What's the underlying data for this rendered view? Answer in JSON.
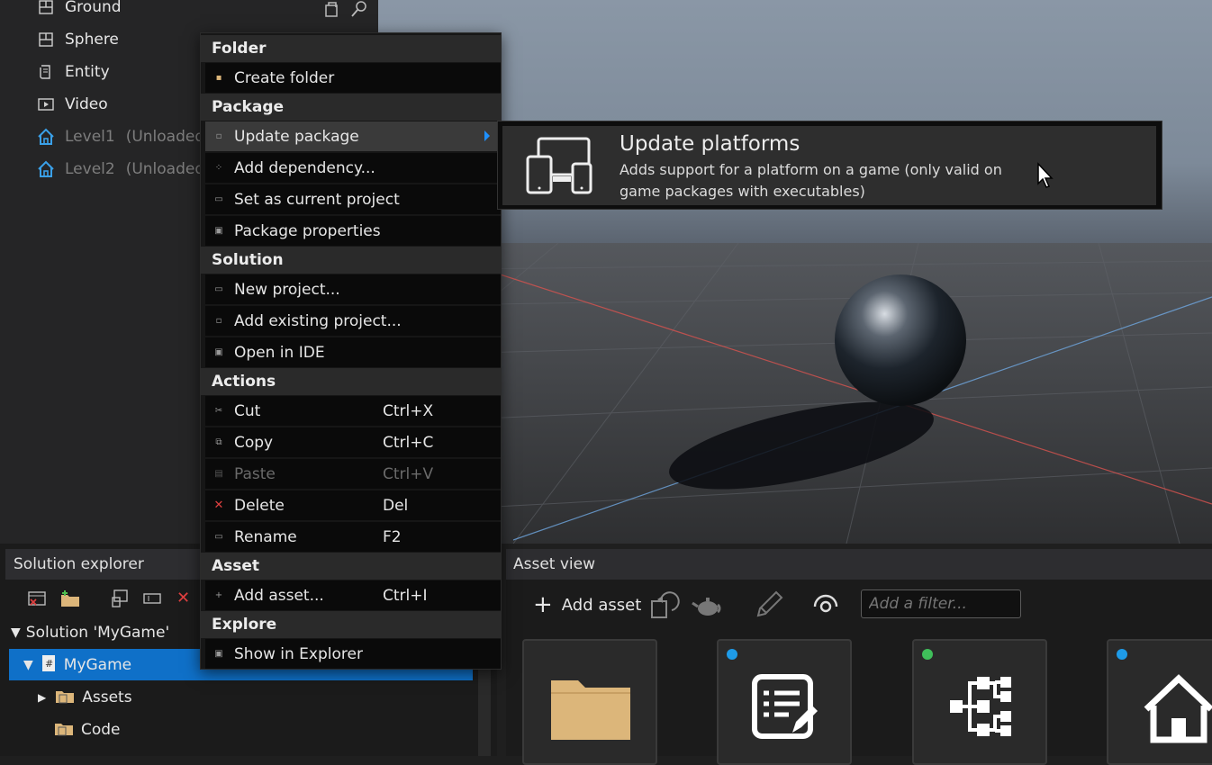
{
  "scene_tree": {
    "items": [
      {
        "label": "Ground",
        "icon": "entity-mesh-icon",
        "extra": ""
      },
      {
        "label": "Sphere",
        "icon": "entity-mesh-icon",
        "extra": ""
      },
      {
        "label": "Entity",
        "icon": "entity-script-icon",
        "extra": ""
      },
      {
        "label": "Video",
        "icon": "video-icon",
        "extra": ""
      },
      {
        "label": "Level1",
        "icon": "home-icon",
        "extra": "(Unloaded)"
      },
      {
        "label": "Level2",
        "icon": "home-icon",
        "extra": "(Unloaded)"
      }
    ]
  },
  "context_menu": {
    "sections": {
      "folder": "Folder",
      "package": "Package",
      "solution": "Solution",
      "actions": "Actions",
      "asset": "Asset",
      "explore": "Explore"
    },
    "items": {
      "create_folder": "Create folder",
      "update_package": "Update package",
      "add_dependency": "Add dependency...",
      "set_current": "Set as current project",
      "package_properties": "Package properties",
      "new_project": "New project...",
      "add_existing": "Add existing project...",
      "open_ide": "Open in IDE",
      "cut": "Cut",
      "copy": "Copy",
      "paste": "Paste",
      "delete": "Delete",
      "rename": "Rename",
      "add_asset": "Add asset...",
      "show_explorer": "Show in Explorer"
    },
    "shortcuts": {
      "cut": "Ctrl+X",
      "copy": "Ctrl+C",
      "paste": "Ctrl+V",
      "delete": "Del",
      "rename": "F2",
      "add_asset": "Ctrl+I"
    }
  },
  "submenu": {
    "title": "Update platforms",
    "description": "Adds support for a platform on a game (only valid on game packages with executables)",
    "icon": "devices-icon"
  },
  "solution_explorer": {
    "title": "Solution explorer",
    "solution": "Solution 'MyGame'",
    "project": "MyGame",
    "assets": "Assets",
    "code": "Code"
  },
  "asset_view": {
    "title": "Asset view",
    "add_asset": "Add asset",
    "filter_placeholder": "Add a filter...",
    "tiles": [
      {
        "icon": "folder-icon",
        "dot": ""
      },
      {
        "icon": "script-edit-icon",
        "dot": "#1e9be8"
      },
      {
        "icon": "graph-icon",
        "dot": "#3fbf5a"
      },
      {
        "icon": "home-icon",
        "dot": "#1e9be8"
      }
    ]
  },
  "colors": {
    "accent": "#0f70c8",
    "highlight_blue": "#1e90ff",
    "folder": "#dcb67a"
  }
}
